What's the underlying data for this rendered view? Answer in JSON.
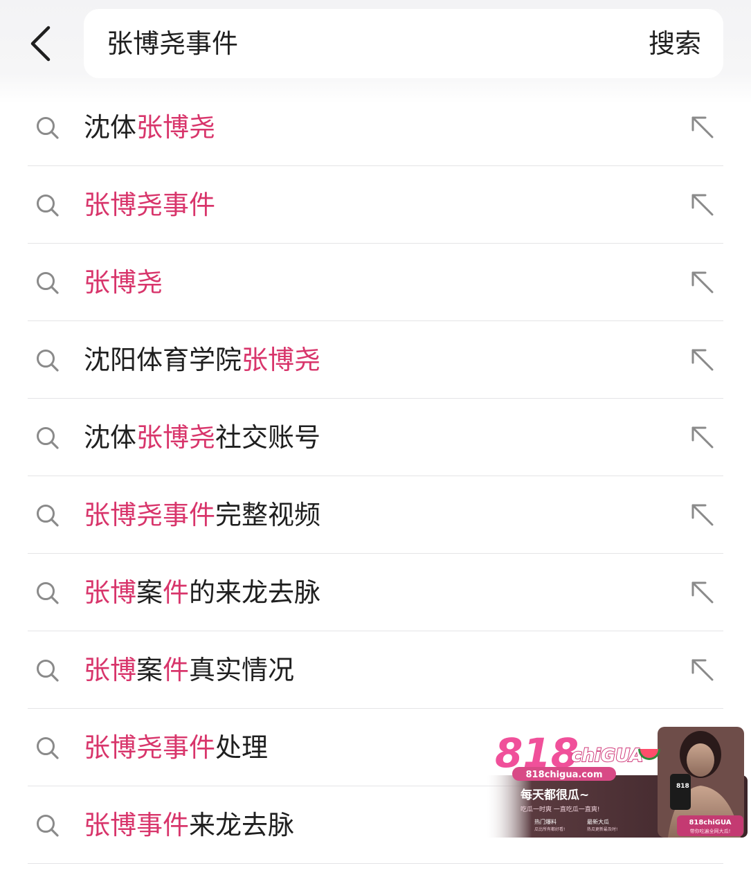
{
  "header": {
    "query": "张博尧事件",
    "search_label": "搜索"
  },
  "suggestions": [
    {
      "parts": [
        {
          "t": "沈体",
          "hl": false
        },
        {
          "t": "张博尧",
          "hl": true
        }
      ]
    },
    {
      "parts": [
        {
          "t": "张博尧事件",
          "hl": true
        }
      ]
    },
    {
      "parts": [
        {
          "t": "张博尧",
          "hl": true
        }
      ]
    },
    {
      "parts": [
        {
          "t": "沈阳体育学院",
          "hl": false
        },
        {
          "t": "张博尧",
          "hl": true
        }
      ]
    },
    {
      "parts": [
        {
          "t": "沈体",
          "hl": false
        },
        {
          "t": "张博尧",
          "hl": true
        },
        {
          "t": "社交账号",
          "hl": false
        }
      ]
    },
    {
      "parts": [
        {
          "t": "张博尧事件",
          "hl": true
        },
        {
          "t": "完整视频",
          "hl": false
        }
      ]
    },
    {
      "parts": [
        {
          "t": "张博",
          "hl": true
        },
        {
          "t": "案",
          "hl": false
        },
        {
          "t": "件",
          "hl": true
        },
        {
          "t": "的来龙去脉",
          "hl": false
        }
      ]
    },
    {
      "parts": [
        {
          "t": "张博",
          "hl": true
        },
        {
          "t": "案",
          "hl": false
        },
        {
          "t": "件",
          "hl": true
        },
        {
          "t": "真实情况",
          "hl": false
        }
      ]
    },
    {
      "parts": [
        {
          "t": "张博尧事件",
          "hl": true
        },
        {
          "t": "处理",
          "hl": false
        }
      ]
    },
    {
      "parts": [
        {
          "t": "张博事件",
          "hl": true
        },
        {
          "t": "来龙去脉",
          "hl": false
        }
      ]
    }
  ],
  "watermark": {
    "logo": "818chiGUA",
    "site": "818chigua.com",
    "slogan": "每天都很瓜~",
    "tagline": "吃瓜一时爽 一直吃瓜一直爽!",
    "badge_left": "热门爆料",
    "badge_left_sub": "瓜比所有都好看!",
    "badge_right": "最新大瓜",
    "badge_right_sub": "热瓜更新最及时!",
    "corner_brand": "818chiGUA",
    "corner_sub": "带你吃遍全网大瓜!",
    "photo_badge": "818"
  },
  "colors": {
    "highlight": "#d8356b",
    "text": "#1f1f1f",
    "icon": "#8a8a8a",
    "divider": "#e4e4e6"
  },
  "icons": {
    "back": "chevron-left-icon",
    "search": "search-icon",
    "fill": "arrow-up-left-icon"
  }
}
